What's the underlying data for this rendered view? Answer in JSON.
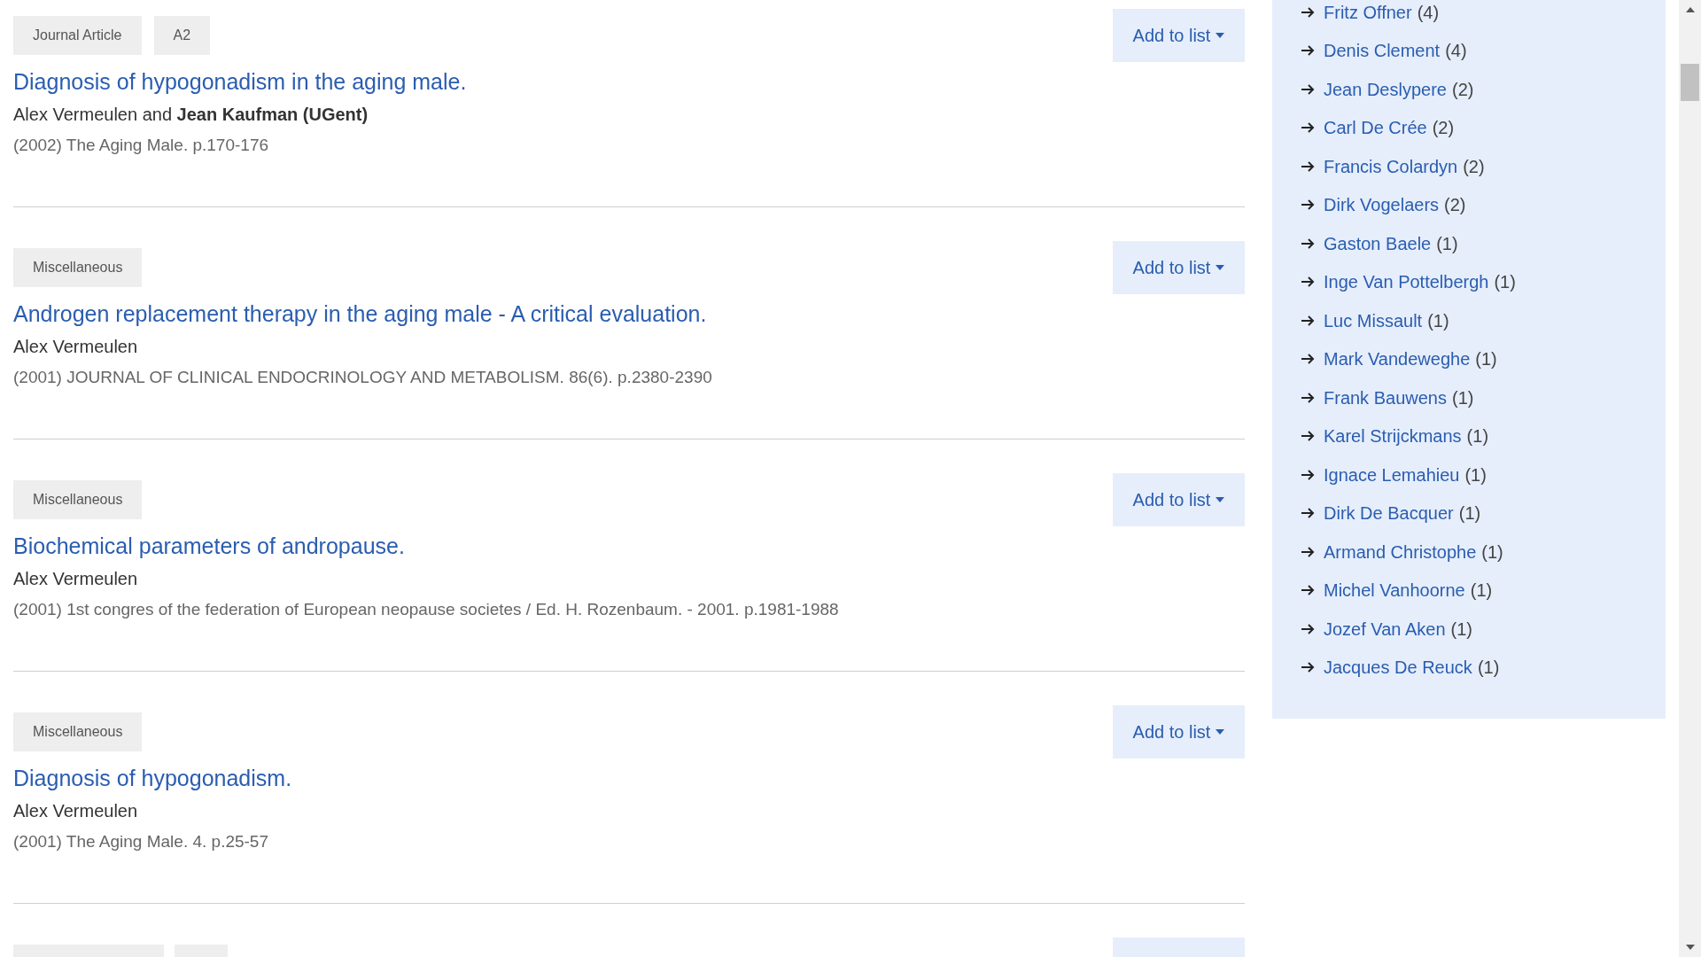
{
  "results": [
    {
      "kind": "full",
      "tags": [
        "Journal Article",
        "A2"
      ],
      "title": "Diagnosis of hypogonadism in the aging male.",
      "authors": "Alex Vermeulen and **Jean Kaufman (UGent)**",
      "source": "(2002) The Aging Male. p.170-176",
      "action": "Add to list"
    },
    {
      "kind": "full",
      "tags": [
        "Miscellaneous"
      ],
      "title": "Androgen replacement therapy in the aging male - A critical evaluation.",
      "authors": "Alex Vermeulen",
      "source": "(2001) JOURNAL OF CLINICAL ENDOCRINOLOGY AND METABOLISM. 86(6). p.2380-2390",
      "action": "Add to list"
    },
    {
      "kind": "full",
      "tags": [
        "Miscellaneous"
      ],
      "title": "Biochemical parameters of andropause.",
      "authors": "Alex Vermeulen",
      "source": "(2001) 1st congres of the federation of European neopause societes / Ed. H. Rozenbaum. - 2001. p.1981-1988",
      "action": "Add to list"
    },
    {
      "kind": "full",
      "tags": [
        "Miscellaneous"
      ],
      "title": "Diagnosis of hypogonadism.",
      "authors": "Alex Vermeulen",
      "source": "(2001) The Aging Male. 4. p.25-57",
      "action": "Add to list"
    },
    {
      "kind": "cut_off"
    }
  ],
  "coauthors": [
    {
      "name": "Fritz Offner",
      "count": "(4)"
    },
    {
      "name": "Denis Clement",
      "count": "(4)"
    },
    {
      "name": "Jean Deslypere",
      "count": "(2)"
    },
    {
      "name": "Carl De Crée",
      "count": "(2)"
    },
    {
      "name": "Francis Colardyn",
      "count": "(2)"
    },
    {
      "name": "Dirk Vogelaers",
      "count": "(2)"
    },
    {
      "name": "Gaston Baele",
      "count": "(1)"
    },
    {
      "name": "Inge Van Pottelbergh",
      "count": "(1)"
    },
    {
      "name": "Luc Missault",
      "count": "(1)"
    },
    {
      "name": "Mark Vandeweghe",
      "count": "(1)"
    },
    {
      "name": "Frank Bauwens",
      "count": "(1)"
    },
    {
      "name": "Karel Strijckmans",
      "count": "(1)"
    },
    {
      "name": "Ignace Lemahieu",
      "count": "(1)"
    },
    {
      "name": "Dirk De Bacquer",
      "count": "(1)"
    },
    {
      "name": "Armand Christophe",
      "count": "(1)"
    },
    {
      "name": "Michel Vanhoorne",
      "count": "(1)"
    },
    {
      "name": "Jozef Van Aken",
      "count": "(1)"
    },
    {
      "name": "Jacques De Reuck",
      "count": "(1)"
    }
  ]
}
